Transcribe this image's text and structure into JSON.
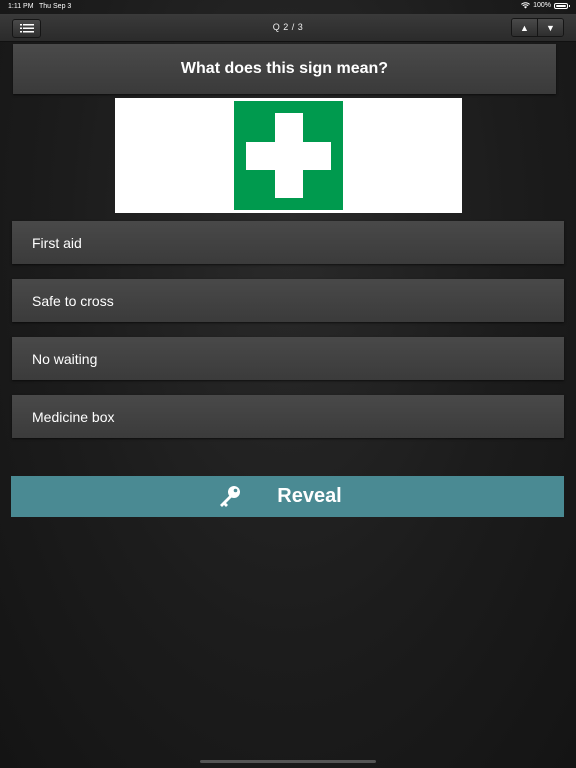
{
  "status_bar": {
    "time": "1:11 PM",
    "date": "Thu Sep 3",
    "battery": "100%"
  },
  "nav": {
    "title": "Q 2 / 3",
    "menu_icon": "list-icon",
    "up_icon": "up-arrow-icon",
    "down_icon": "down-arrow-icon",
    "up_glyph": "▲",
    "down_glyph": "▼"
  },
  "question": {
    "text": "What does this sign mean?"
  },
  "sign": {
    "icon": "first-aid-sign-icon",
    "background_color": "#009a4e"
  },
  "answers": [
    {
      "label": "First aid"
    },
    {
      "label": "Safe to cross"
    },
    {
      "label": "No waiting"
    },
    {
      "label": "Medicine box"
    }
  ],
  "reveal": {
    "label": "Reveal",
    "icon": "key-icon",
    "color": "#4a8a93"
  }
}
